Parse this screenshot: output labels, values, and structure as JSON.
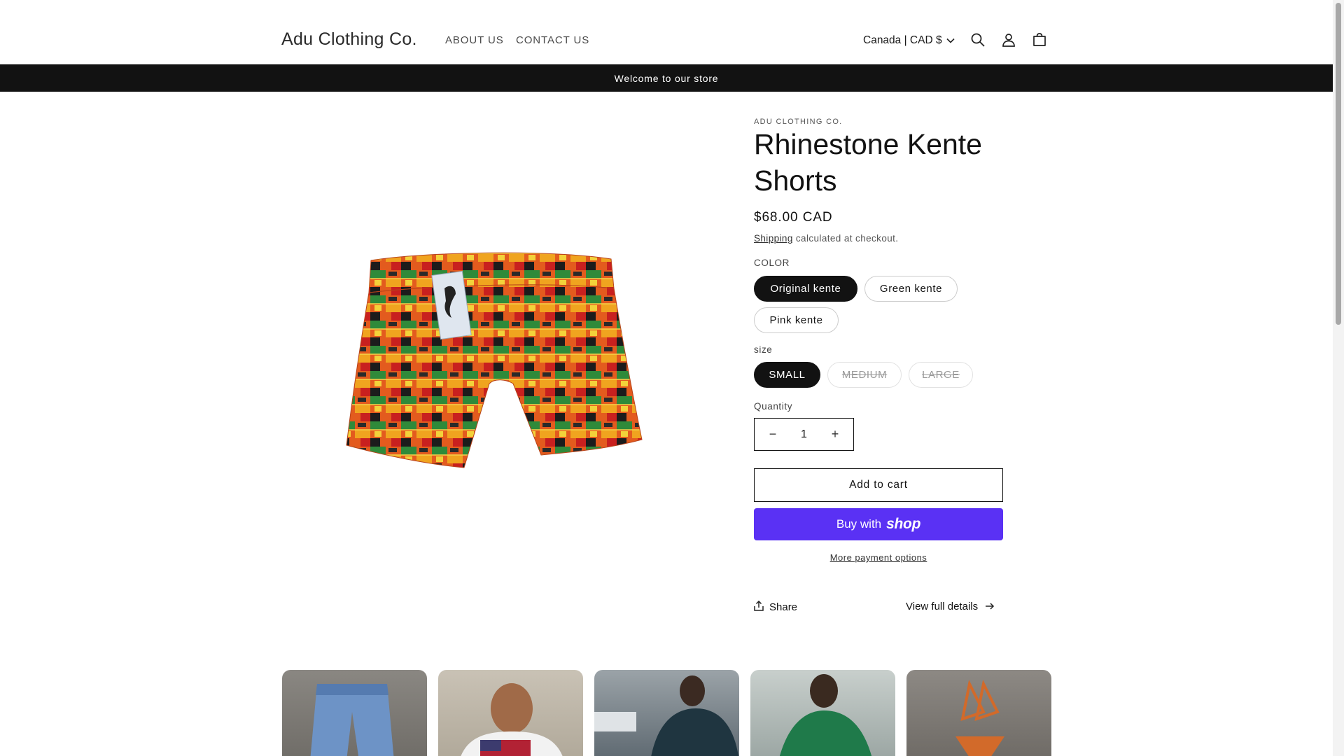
{
  "header": {
    "logo": "Adu Clothing Co.",
    "nav": [
      {
        "label": "ABOUT US"
      },
      {
        "label": "CONTACT US"
      }
    ],
    "locale": "Canada | CAD $",
    "icons": [
      "search-icon",
      "account-icon",
      "cart-icon"
    ]
  },
  "announcement": "Welcome to our store",
  "product": {
    "vendor": "ADU CLOTHING CO.",
    "title": "Rhinestone Kente Shorts",
    "price": "$68.00 CAD",
    "shipping_link": "Shipping",
    "shipping_rest": " calculated at checkout.",
    "color_label": "COLOR",
    "colors": [
      {
        "label": "Original kente",
        "selected": true
      },
      {
        "label": "Green kente",
        "selected": false
      },
      {
        "label": "Pink kente",
        "selected": false
      }
    ],
    "size_label": "size",
    "sizes": [
      {
        "label": "SMALL",
        "selected": true,
        "available": true
      },
      {
        "label": "MEDIUM",
        "selected": false,
        "available": false
      },
      {
        "label": "LARGE",
        "selected": false,
        "available": false
      }
    ],
    "quantity_label": "Quantity",
    "quantity": "1",
    "qty_minus": "−",
    "qty_plus": "+",
    "add_to_cart": "Add to cart",
    "buy_with": "Buy with",
    "shop_brand": "shop",
    "more_payment": "More payment options",
    "share": "Share",
    "view_details": "View full details"
  },
  "colors": {
    "accent_shop": "#5a31f4",
    "announcement_bg": "#121212",
    "selected_pill": "#121212"
  }
}
